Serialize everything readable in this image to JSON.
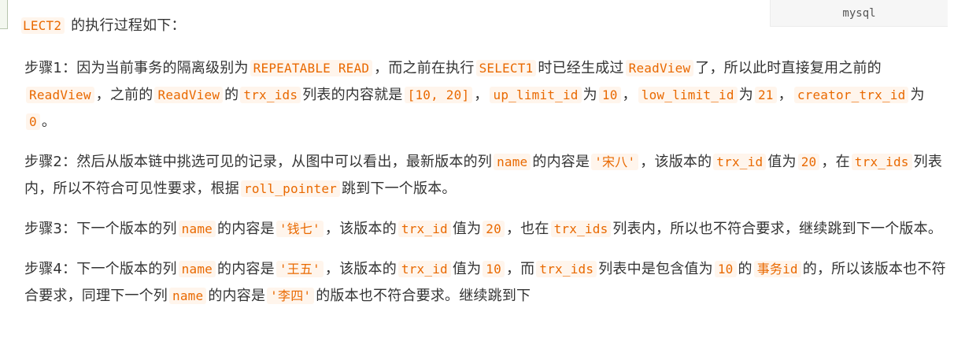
{
  "language_label": "mysql",
  "intro": {
    "code": "LECT2",
    "text": "的执行过程如下："
  },
  "steps": [
    {
      "segments": [
        {
          "t": "步骤1：因为当前事务的隔离级别为"
        },
        {
          "c": "REPEATABLE READ"
        },
        {
          "t": "，而之前在执行"
        },
        {
          "c": "SELECT1"
        },
        {
          "t": "时已经生成过"
        },
        {
          "c": "ReadView"
        },
        {
          "t": "了，所以此时直接复用之前的"
        },
        {
          "c": "ReadView"
        },
        {
          "t": "，之前的"
        },
        {
          "c": "ReadView"
        },
        {
          "t": "的"
        },
        {
          "c": "trx_ids"
        },
        {
          "t": "列表的内容就是"
        },
        {
          "c": "[10, 20]"
        },
        {
          "t": "，"
        },
        {
          "c": "up_limit_id"
        },
        {
          "t": "为"
        },
        {
          "c": "10"
        },
        {
          "t": "，"
        },
        {
          "c": "low_limit_id"
        },
        {
          "t": "为"
        },
        {
          "c": "21"
        },
        {
          "t": "，"
        },
        {
          "c": "creator_trx_id"
        },
        {
          "t": "为"
        },
        {
          "c": "0"
        },
        {
          "t": "。"
        }
      ]
    },
    {
      "segments": [
        {
          "t": "步骤2：然后从版本链中挑选可见的记录，从图中可以看出，最新版本的列"
        },
        {
          "c": "name"
        },
        {
          "t": "的内容是"
        },
        {
          "c": "'宋八'"
        },
        {
          "t": "，该版本的"
        },
        {
          "c": "trx_id"
        },
        {
          "t": "值为"
        },
        {
          "c": "20"
        },
        {
          "t": "，在"
        },
        {
          "c": "trx_ids"
        },
        {
          "t": "列表内，所以不符合可见性要求，根据"
        },
        {
          "c": "roll_pointer"
        },
        {
          "t": "跳到下一个版本。"
        }
      ]
    },
    {
      "segments": [
        {
          "t": "步骤3：下一个版本的列"
        },
        {
          "c": "name"
        },
        {
          "t": "的内容是"
        },
        {
          "c": "'钱七'"
        },
        {
          "t": "，该版本的"
        },
        {
          "c": "trx_id"
        },
        {
          "t": "值为"
        },
        {
          "c": "20"
        },
        {
          "t": "，也在"
        },
        {
          "c": "trx_ids"
        },
        {
          "t": "列表内，所以也不符合要求，继续跳到下一个版本。"
        }
      ]
    },
    {
      "segments": [
        {
          "t": "步骤4：下一个版本的列"
        },
        {
          "c": "name"
        },
        {
          "t": "的内容是"
        },
        {
          "c": "'王五'"
        },
        {
          "t": "，该版本的"
        },
        {
          "c": "trx_id"
        },
        {
          "t": "值为"
        },
        {
          "c": "10"
        },
        {
          "t": "，而"
        },
        {
          "c": "trx_ids"
        },
        {
          "t": "列表中是包含值为"
        },
        {
          "c": "10"
        },
        {
          "t": "的"
        },
        {
          "c": "事务id"
        },
        {
          "t": "的，所以该版本也不符合要求，同理下一个列"
        },
        {
          "c": "name"
        },
        {
          "t": "的内容是"
        },
        {
          "c": "'李四'"
        },
        {
          "t": "的版本也不符合要求。继续跳到下"
        }
      ]
    }
  ]
}
